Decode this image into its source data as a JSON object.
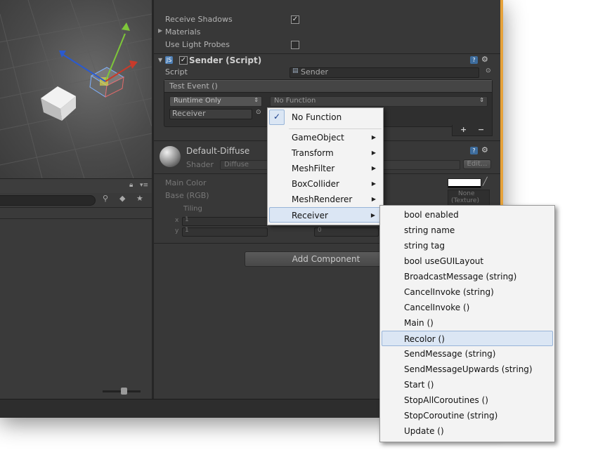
{
  "inspector": {
    "renderer": {
      "receive_shadows_label": "Receive Shadows",
      "materials_label": "Materials",
      "use_light_probes_label": "Use Light Probes",
      "receive_shadows_check": "✓"
    },
    "sender": {
      "js_badge": "JS",
      "enabled_check": "✓",
      "title": "Sender (Script)",
      "script_label": "Script",
      "script_value": "Sender",
      "event_header": "Test Event ()",
      "runtime_value": "Runtime Only",
      "function_value": "No Function",
      "target_value": "Receiver",
      "add_label": "+",
      "remove_label": "−",
      "help_icon": "?",
      "gear_icon": "⚙"
    },
    "material": {
      "name": "Default-Diffuse",
      "shader_label": "Shader",
      "shader_value": "Diffuse",
      "edit_label": "Edit...",
      "main_color_label": "Main Color",
      "base_label": "Base (RGB)",
      "tiling_label": "Tiling",
      "x_label": "x",
      "x_value": "1",
      "y_label": "y",
      "y_value": "1",
      "offset_y_value": "0",
      "texture_none": "None",
      "texture_type": "(Texture)"
    },
    "add_component_label": "Add Component"
  },
  "menu_primary": {
    "checked_item": "No Function",
    "check_glyph": "✓",
    "items": [
      "GameObject",
      "Transform",
      "MeshFilter",
      "BoxCollider",
      "MeshRenderer",
      "Receiver"
    ],
    "selected": "Receiver"
  },
  "menu_receiver": {
    "items": [
      "bool enabled",
      "string name",
      "string tag",
      "bool useGUILayout",
      "BroadcastMessage (string)",
      "CancelInvoke (string)",
      "CancelInvoke ()",
      "Main ()",
      "Recolor ()",
      "SendMessage (string)",
      "SendMessageUpwards (string)",
      "Start ()",
      "StopAllCoroutines ()",
      "StopCoroutine (string)",
      "Update ()"
    ],
    "highlighted": "Recolor ()"
  },
  "colors": {
    "editor_bg": "#383838",
    "frame_accent": "#e6a23a",
    "menu_bg": "#f3f3f3",
    "menu_highlight": "#dbe6f4",
    "gizmo_green": "#7ec63a",
    "gizmo_red": "#c83a2a",
    "gizmo_blue": "#2a5ad0"
  }
}
